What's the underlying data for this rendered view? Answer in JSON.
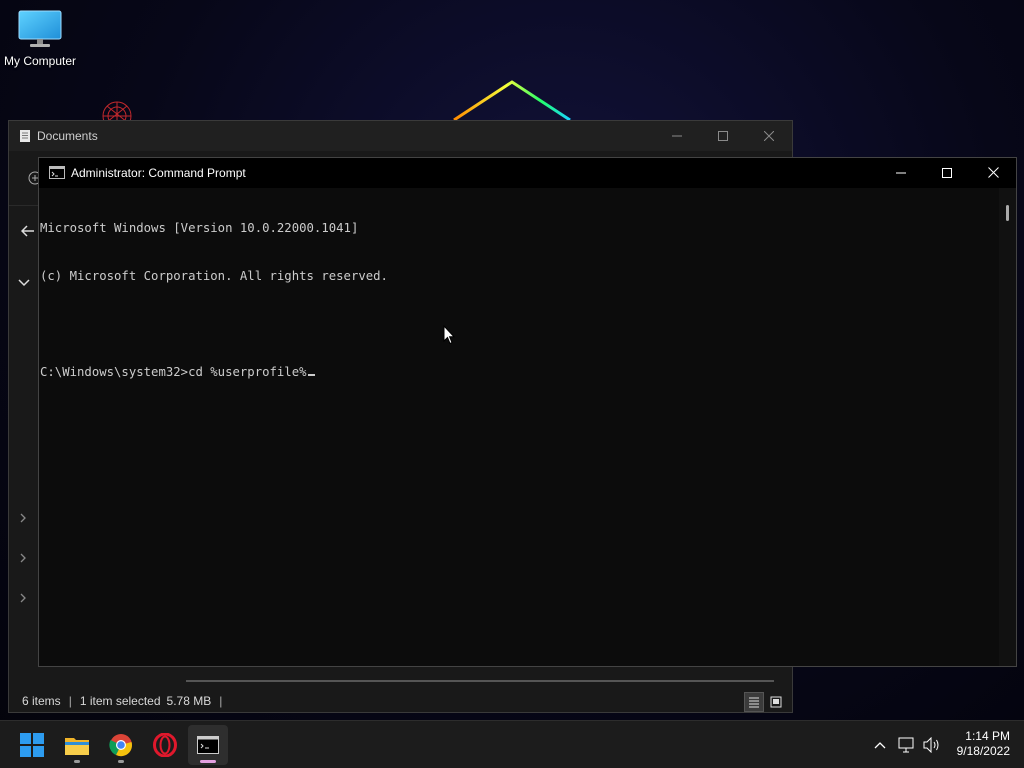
{
  "desktop": {
    "icons": [
      {
        "label": "My Computer",
        "icon": "monitor-icon"
      }
    ]
  },
  "explorer": {
    "title": "Documents",
    "status": {
      "items": "6 items",
      "selected": "1 item selected",
      "size": "5.78 MB"
    }
  },
  "cmd": {
    "title": "Administrator: Command Prompt",
    "lines": [
      "Microsoft Windows [Version 10.0.22000.1041]",
      "(c) Microsoft Corporation. All rights reserved.",
      "",
      "C:\\Windows\\system32>cd %userprofile%"
    ]
  },
  "taskbar": {
    "apps": [
      "start-icon",
      "file-explorer-icon",
      "chrome-icon",
      "opera-icon",
      "terminal-icon"
    ],
    "tray": [
      "chevron-up-icon",
      "network-icon",
      "volume-icon"
    ],
    "clock": {
      "time": "1:14 PM",
      "date": "9/18/2022"
    }
  },
  "colors": {
    "console_bg": "#0c0c0c",
    "console_text": "#cccccc",
    "taskbar": "#1c1c1c",
    "active_indicator": "#e4a0e0"
  }
}
